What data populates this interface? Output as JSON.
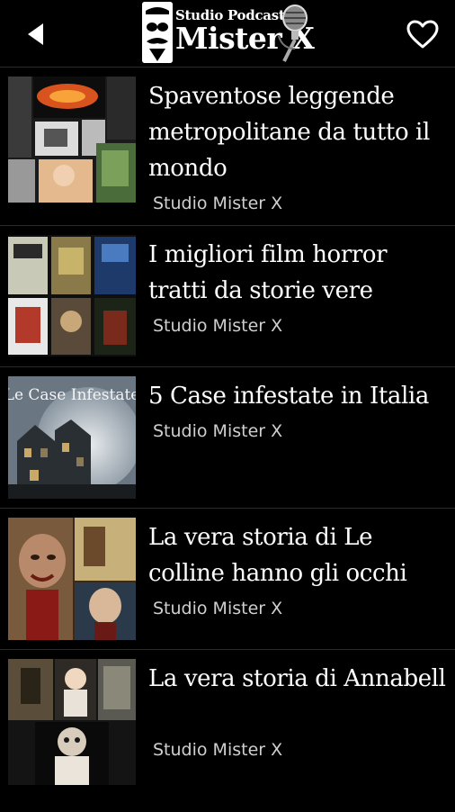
{
  "header": {
    "logo_top": "Studio Podcast",
    "logo_bottom": "Mister X"
  },
  "items": [
    {
      "title": "Spaventose leggende metropolitane da tutto il mondo",
      "author": "Studio Mister X"
    },
    {
      "title": "I migliori film horror tratti da storie vere",
      "author": "Studio Mister X"
    },
    {
      "title": "5 Case infestate in Italia",
      "author": "Studio Mister X",
      "thumb_text": "Le Case Infestate"
    },
    {
      "title": "La vera storia di Le colline hanno gli occhi",
      "author": "Studio Mister X"
    },
    {
      "title": "La vera storia di Annabell",
      "author": "Studio Mister X"
    }
  ],
  "colors": {
    "background": "#000000",
    "text": "#ffffff",
    "subtext": "#cfcfcf",
    "divider": "#2a2a2a"
  },
  "icons": {
    "back": "back-arrow-icon",
    "favorite": "heart-outline-icon"
  }
}
